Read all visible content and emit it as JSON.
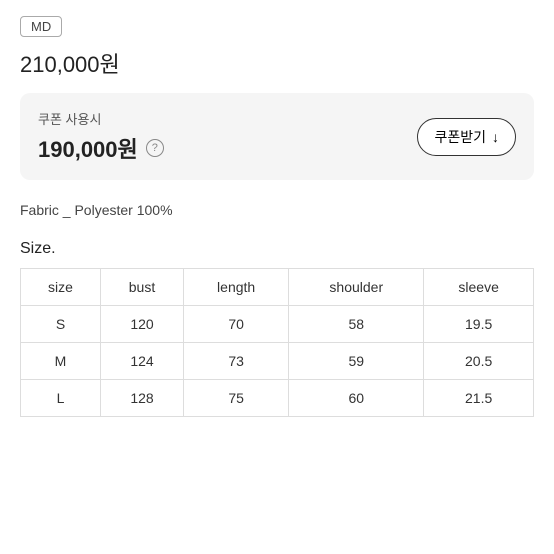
{
  "badge": {
    "label": "MD"
  },
  "price": {
    "original": "210,000원",
    "coupon": "190,000원"
  },
  "coupon": {
    "label": "쿠폰 사용시",
    "button_label": "쿠폰받기",
    "button_icon": "↓",
    "question_icon": "?"
  },
  "fabric": {
    "label": "Fabric _ Polyester 100%"
  },
  "size_section": {
    "title": "Size.",
    "columns": [
      "size",
      "bust",
      "length",
      "shoulder",
      "sleeve"
    ],
    "rows": [
      [
        "S",
        "120",
        "70",
        "58",
        "19.5"
      ],
      [
        "M",
        "124",
        "73",
        "59",
        "20.5"
      ],
      [
        "L",
        "128",
        "75",
        "60",
        "21.5"
      ]
    ]
  }
}
